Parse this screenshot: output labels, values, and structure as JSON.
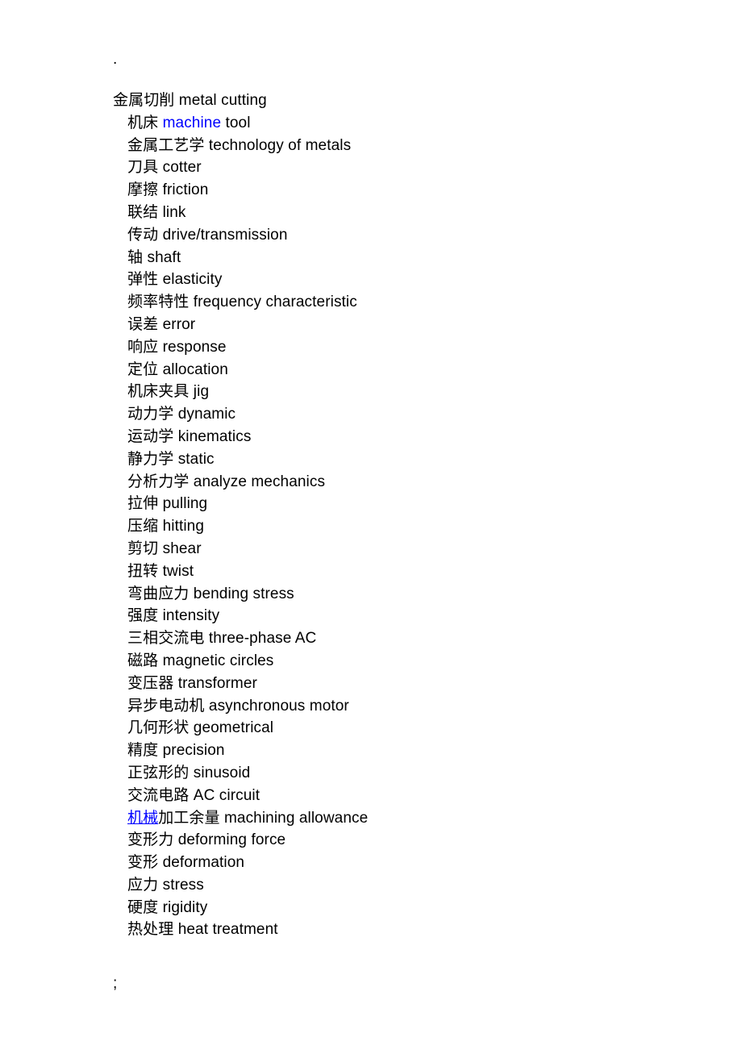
{
  "document": {
    "background_color": "#ffffff",
    "text_color": "#000000",
    "link_color": "#0000ff",
    "stray_mark_top": ".",
    "stray_mark_bottom": ";"
  },
  "glossary": {
    "heading": {
      "term": "金属切削",
      "gloss": "metal cutting"
    },
    "entries": [
      {
        "term_pre": "机床 ",
        "term_link": "machine",
        "term_link_underlined": false,
        "gloss": " tool",
        "link_inline": true
      },
      {
        "term": "金属工艺学",
        "gloss": "technology of metals"
      },
      {
        "term": "刀具",
        "gloss": "cotter"
      },
      {
        "term": "摩擦",
        "gloss": "friction"
      },
      {
        "term": "联结",
        "gloss": "link"
      },
      {
        "term": "传动",
        "gloss": "drive/transmission"
      },
      {
        "term": "轴",
        "gloss": "shaft"
      },
      {
        "term": "弹性",
        "gloss": "elasticity"
      },
      {
        "term": "频率特性",
        "gloss": "frequency characteristic"
      },
      {
        "term": "误差",
        "gloss": "error"
      },
      {
        "term": "响应",
        "gloss": "response"
      },
      {
        "term": "定位",
        "gloss": "allocation"
      },
      {
        "term": "机床夹具",
        "gloss": "jig"
      },
      {
        "term": "动力学",
        "gloss": "dynamic"
      },
      {
        "term": "运动学",
        "gloss": "kinematics"
      },
      {
        "term": "静力学",
        "gloss": "static"
      },
      {
        "term": "分析力学",
        "gloss": "analyze mechanics"
      },
      {
        "term": "拉伸",
        "gloss": "pulling"
      },
      {
        "term": "压缩",
        "gloss": "hitting"
      },
      {
        "term": "剪切",
        "gloss": "shear"
      },
      {
        "term": "扭转",
        "gloss": "twist"
      },
      {
        "term": "弯曲应力",
        "gloss": "bending stress"
      },
      {
        "term": "强度",
        "gloss": "intensity"
      },
      {
        "term": "三相交流电",
        "gloss": "three-phase AC"
      },
      {
        "term": "磁路",
        "gloss": "magnetic circles"
      },
      {
        "term": "变压器",
        "gloss": "transformer"
      },
      {
        "term": "异步电动机",
        "gloss": "asynchronous motor"
      },
      {
        "term": "几何形状",
        "gloss": "geometrical"
      },
      {
        "term": "精度",
        "gloss": "precision"
      },
      {
        "term": "正弦形的",
        "gloss": "sinusoid"
      },
      {
        "term": "交流电路",
        "gloss": "AC circuit"
      },
      {
        "term_link": "机械",
        "term_link_underlined": true,
        "term_post": "加工余量",
        "gloss": " machining allowance",
        "link_inline": true
      },
      {
        "term": "变形力",
        "gloss": "deforming force"
      },
      {
        "term": "变形",
        "gloss": "deformation"
      },
      {
        "term": "应力",
        "gloss": "stress"
      },
      {
        "term": "硬度",
        "gloss": "rigidity"
      },
      {
        "term": "热处理",
        "gloss": "heat treatment"
      }
    ]
  }
}
